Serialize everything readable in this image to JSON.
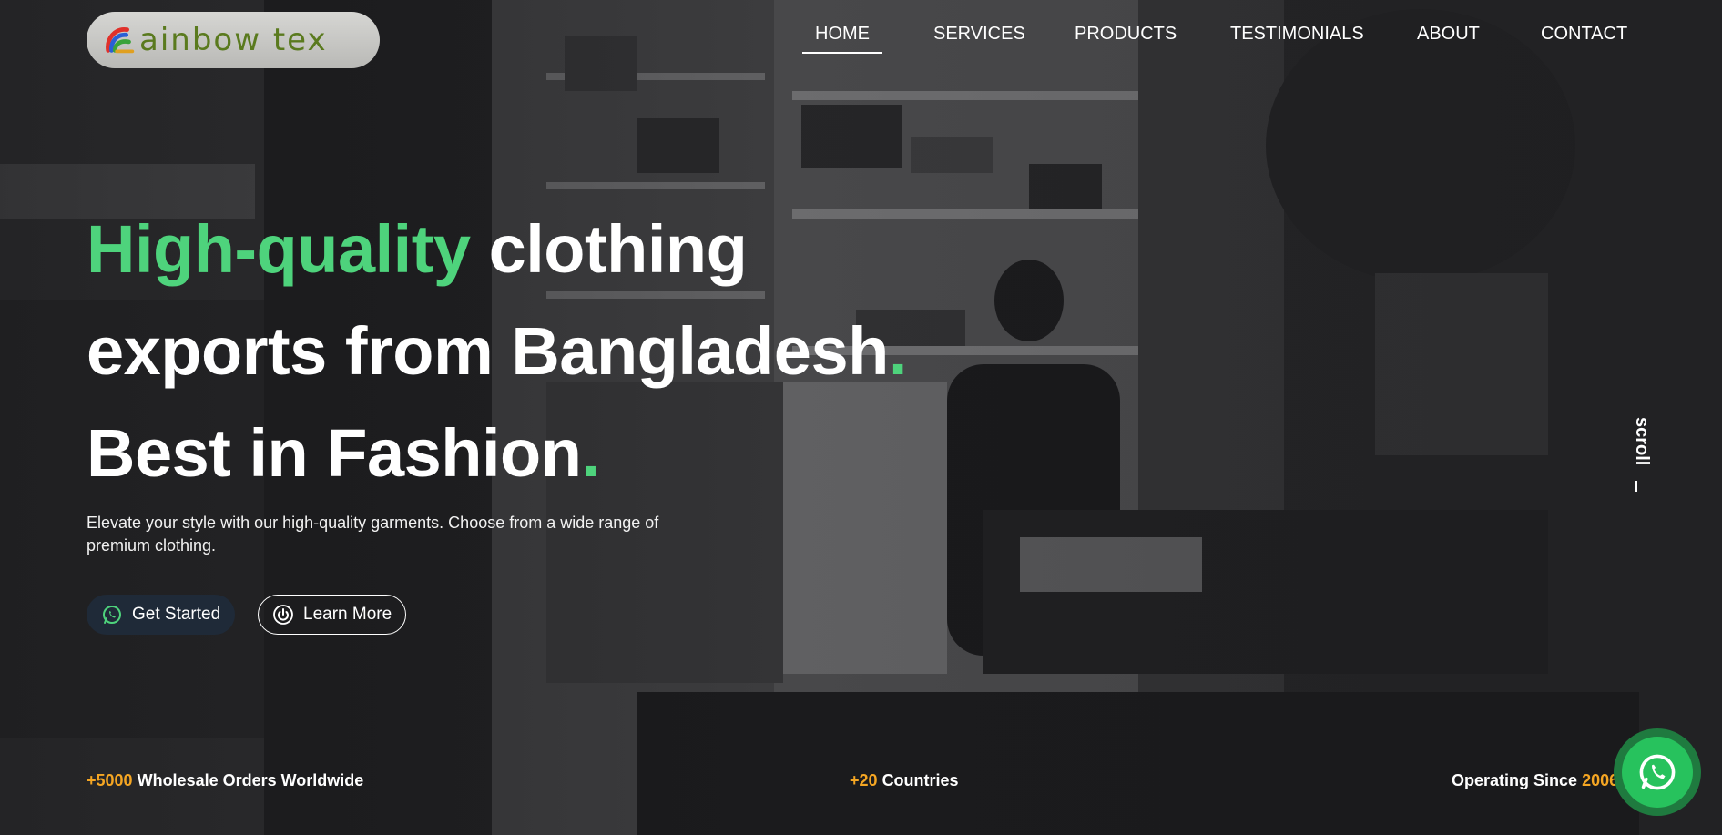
{
  "brand": {
    "logo_text": "ainbow tex"
  },
  "nav": {
    "items": [
      {
        "label": "HOME",
        "active": true
      },
      {
        "label": "SERVICES",
        "active": false
      },
      {
        "label": "PRODUCTS",
        "active": false
      },
      {
        "label": "TESTIMONIALS",
        "active": false
      },
      {
        "label": "ABOUT",
        "active": false
      },
      {
        "label": "CONTACT",
        "active": false
      }
    ]
  },
  "hero": {
    "headline_green": "High-quality",
    "headline_line1_rest": "clothing",
    "headline_line2": "exports from Bangladesh",
    "headline_line3": "Best in Fashion",
    "dot": ".",
    "subtext": "Elevate your style with our high-quality garments. Choose from a wide range of premium clothing.",
    "primary_button": "Get Started",
    "secondary_button": "Learn More",
    "primary_button_icon": "whatsapp-icon",
    "secondary_button_icon": "power-icon"
  },
  "scroll_label": "scroll",
  "stats": [
    {
      "highlight": "+5000",
      "text": "Wholesale Orders Worldwide"
    },
    {
      "highlight": "+20",
      "text": "Countries"
    },
    {
      "prefix": "Operating Since",
      "highlight": "2006"
    }
  ],
  "colors": {
    "accent_green": "#4ed37c",
    "accent_orange": "#f5a623",
    "primary_button_bg": "#1f2a38",
    "logo_text": "#5a7a1e",
    "whatsapp_green": "#27c25d"
  },
  "floating_button_icon": "whatsapp-icon"
}
